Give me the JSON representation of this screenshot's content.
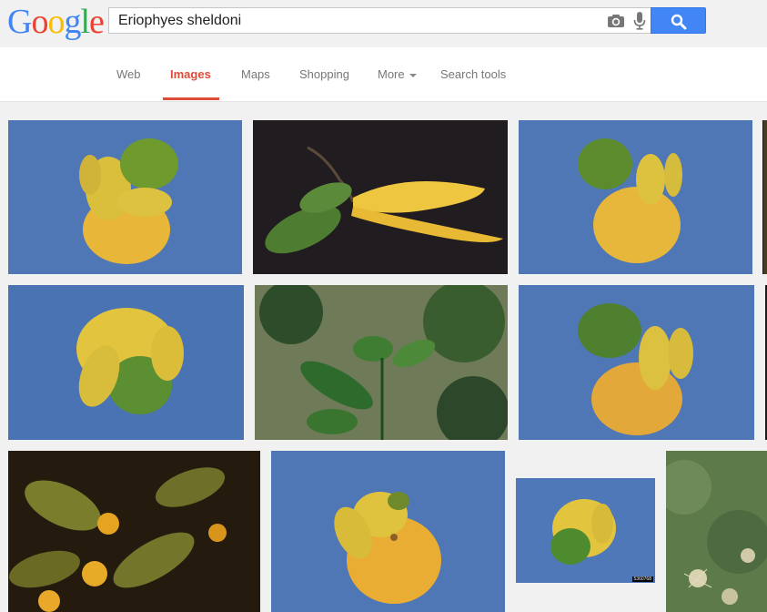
{
  "logo": {
    "text": "Google",
    "letters": [
      "G",
      "o",
      "o",
      "g",
      "l",
      "e"
    ],
    "colors": [
      "#4285f4",
      "#ea4335",
      "#fbbc05",
      "#4285f4",
      "#34a853",
      "#ea4335"
    ]
  },
  "search": {
    "query": "Eriophyes sheldoni",
    "button_color": "#4285f4"
  },
  "nav": {
    "items": [
      {
        "label": "Web",
        "active": false
      },
      {
        "label": "Images",
        "active": true
      },
      {
        "label": "Maps",
        "active": false
      },
      {
        "label": "Shopping",
        "active": false
      },
      {
        "label": "More",
        "active": false,
        "dropdown": true
      },
      {
        "label": "Search tools",
        "active": false
      }
    ],
    "active_color": "#dd4b39"
  },
  "results": {
    "images": [
      {
        "subject": "malformed citrus fruit on blue background"
      },
      {
        "subject": "elongated yellow citrus fruit with leaves on dark background"
      },
      {
        "subject": "malformed citrus fruit on blue background"
      },
      {
        "subject": "malformed yellow-green citrus fruit on blue background"
      },
      {
        "subject": "citrus leaves with mite damage"
      },
      {
        "subject": "malformed citrus fruit on blue background"
      },
      {
        "subject": "citrus flowers and leaves at night"
      },
      {
        "subject": "malformed yellow citrus fruit on blue background"
      },
      {
        "subject": "malformed citrus fruit on blue background",
        "watermark": "5360768"
      },
      {
        "subject": "mites on green leaf surface"
      }
    ]
  }
}
